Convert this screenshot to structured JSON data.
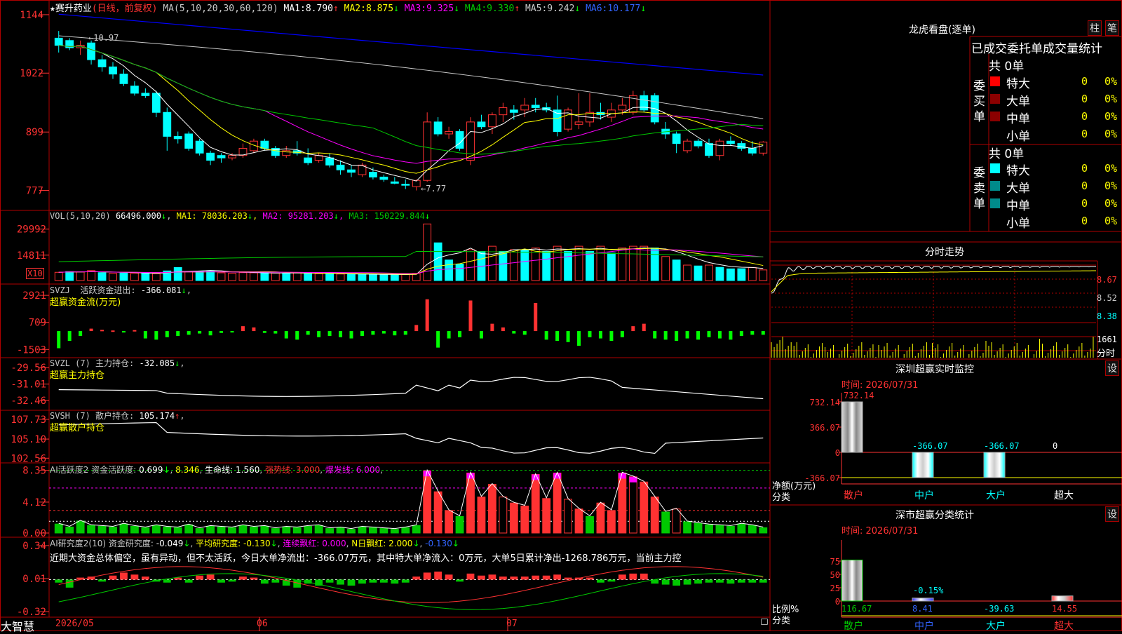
{
  "colors": {
    "up": "#ff3232",
    "down": "#00ffff",
    "border": "#b00000",
    "ma1": "#ffffff",
    "ma2": "#ffff00",
    "ma3": "#ff00ff",
    "ma4": "#00c800",
    "ma5": "#c8c8c8",
    "ma6": "#0000ff"
  },
  "main": {
    "stock_name": "赛升药业",
    "mode": "(日线，前复权)",
    "ma_def": "MA(5,10,20,30,60,120)",
    "ma": [
      {
        "label": "MA1:",
        "value": "8.790",
        "arrow": "↑"
      },
      {
        "label": "MA2:",
        "value": "8.875",
        "arrow": "↓"
      },
      {
        "label": "MA3:",
        "value": "9.325",
        "arrow": "↓"
      },
      {
        "label": "MA4:",
        "value": "9.330",
        "arrow": "↑"
      },
      {
        "label": "MA5:",
        "value": "9.242",
        "arrow": "↓"
      },
      {
        "label": "MA6:",
        "value": "10.177",
        "arrow": "↓"
      }
    ],
    "yticks": [
      "1144",
      "1022",
      "899",
      "777"
    ],
    "high_label": "←10.97",
    "low_label": "←7.77"
  },
  "vol": {
    "title": "VOL(5,10,20)",
    "value": "66496.000",
    "arrow": "↓",
    "ma": [
      {
        "label": "MA1:",
        "value": "78036.203",
        "arrow": "↓"
      },
      {
        "label": "MA2:",
        "value": "95281.203",
        "arrow": "↓"
      },
      {
        "label": "MA3:",
        "value": "150229.844",
        "arrow": "↓"
      }
    ],
    "yticks": [
      "29992",
      "14811"
    ],
    "unit": "X10"
  },
  "svzj": {
    "title": "SVZJ",
    "label": "活跃资金进出:",
    "value": "-366.081",
    "arrow": "↓",
    "extra": ",",
    "subtitle": "超赢资金流(万元)",
    "yticks": [
      "2921",
      "709",
      "-1503"
    ]
  },
  "svzl": {
    "title": "SVZL (7)",
    "label": "主力持仓:",
    "value": "-32.085",
    "arrow": "↓",
    "extra": ",",
    "subtitle": "超赢主力持仓",
    "yticks": [
      "-29.56",
      "-31.01",
      "-32.46"
    ]
  },
  "svsh": {
    "title": "SVSH (7)",
    "label": "散户持仓:",
    "value": "105.174",
    "arrow": "↑",
    "extra": ",",
    "subtitle": "超赢散户持仓",
    "yticks": [
      "107.73",
      "105.10",
      "102.56"
    ]
  },
  "ai1": {
    "title": "AI活跃度2",
    "label": "资金活跃度:",
    "value": "0.699",
    "arrow": "↓",
    "v2": "8.346",
    "lifeline": "生命线: 1.560",
    "strong": "强势线: 3.000",
    "burst": "爆发线: 6.000",
    "yticks": [
      "8.35",
      "4.12",
      "0.00"
    ]
  },
  "ai2": {
    "title": "AI研究度2(10)",
    "label": "资金研究度:",
    "value": "-0.049",
    "arrow": "↓",
    "avg": "平均研究度: -0.130",
    "avg_arrow": "↓",
    "red": "连续飘红: 0.000",
    "nday": "N日飘红: 2.000",
    "nday_arrow": "↓",
    "last": "-0.130",
    "last_arrow": "↓",
    "yticks": [
      "0.34",
      "0.01",
      "-0.32"
    ],
    "comment": "近期大资金总体偏空，虽有异动，但不太活跃，今日大单净流出：-366.07万元，其中特大单净流入：0万元，大单5日累计净出-1268.786万元，当前主力控"
  },
  "xaxis": {
    "app": "大智慧",
    "labels": [
      "2026/05",
      "06",
      "07"
    ]
  },
  "lhb": {
    "title": "龙虎看盘(逐单)",
    "btn1": "柱",
    "btn2": "笔",
    "tabs": [
      "已成交",
      "委托单",
      "成交量统计"
    ],
    "buy": {
      "side": "委买单",
      "total": "共 0单",
      "rows": [
        {
          "name": "特大",
          "val": "0",
          "pct": "0%",
          "color": "#ff0000"
        },
        {
          "name": "大单",
          "val": "0",
          "pct": "0%",
          "color": "#8b0000"
        },
        {
          "name": "中单",
          "val": "0",
          "pct": "0%",
          "color": "#8b0000"
        },
        {
          "name": "小单",
          "val": "0",
          "pct": "0%",
          "color": "#000000"
        }
      ]
    },
    "sell": {
      "side": "委卖单",
      "total": "共 0单",
      "rows": [
        {
          "name": "特大",
          "val": "0",
          "pct": "0%",
          "color": "#00ffff"
        },
        {
          "name": "大单",
          "val": "0",
          "pct": "0%",
          "color": "#008b8b"
        },
        {
          "name": "中单",
          "val": "0",
          "pct": "0%",
          "color": "#008b8b"
        },
        {
          "name": "小单",
          "val": "0",
          "pct": "0%",
          "color": "#000000"
        }
      ]
    }
  },
  "fenshi": {
    "title": "分时走势",
    "yticks": [
      "8.67",
      "8.52",
      "8.38"
    ],
    "vol_label": "1661",
    "unit": "分时"
  },
  "monitor": {
    "title": "深圳超赢实时监控",
    "btn": "设",
    "date": "时间: 2026/07/31",
    "yticks": [
      "732.14",
      "366.07",
      "0",
      "-366.07"
    ],
    "ylabel": "净额(万元)",
    "xlabel": "分类",
    "bars": [
      {
        "cat": "散户",
        "value": "732.14"
      },
      {
        "cat": "中户",
        "value": "-366.07"
      },
      {
        "cat": "大户",
        "value": "-366.07"
      },
      {
        "cat": "超大",
        "value": "0"
      }
    ]
  },
  "classify": {
    "title": "深市超赢分类统计",
    "btn": "设",
    "date": "时间: 2026/07/31",
    "yticks": [
      "75",
      "50",
      "25",
      "0"
    ],
    "ylabel": "比例%",
    "xlabel": "分类",
    "bars": [
      {
        "cat": "散户",
        "value": "116.67"
      },
      {
        "cat": "中户",
        "value": "8.41",
        "note": "-0.15%"
      },
      {
        "cat": "大户",
        "value": "-39.63"
      },
      {
        "cat": "超大",
        "value": "14.55"
      }
    ]
  },
  "chart_data": [
    {
      "type": "candlestick",
      "title": "赛升药业",
      "ylim": [
        7.5,
        11.6
      ],
      "candles": [
        [
          10.95,
          11.1,
          10.65,
          10.8
        ],
        [
          10.9,
          10.95,
          10.7,
          10.75
        ],
        [
          10.75,
          10.9,
          10.6,
          10.8
        ],
        [
          10.85,
          10.9,
          10.4,
          10.5
        ],
        [
          10.5,
          10.6,
          10.25,
          10.35
        ],
        [
          10.35,
          10.45,
          10.1,
          10.2
        ],
        [
          10.2,
          10.3,
          9.95,
          10.0
        ],
        [
          9.95,
          10.05,
          9.75,
          9.8
        ],
        [
          9.8,
          9.9,
          9.7,
          9.75
        ],
        [
          9.8,
          9.85,
          9.3,
          9.4
        ],
        [
          9.4,
          9.5,
          8.6,
          8.9
        ],
        [
          8.9,
          9.0,
          8.75,
          8.85
        ],
        [
          8.95,
          9.0,
          8.6,
          8.65
        ],
        [
          8.8,
          8.85,
          8.5,
          8.55
        ],
        [
          8.55,
          8.6,
          8.3,
          8.4
        ],
        [
          8.5,
          8.55,
          8.35,
          8.45
        ],
        [
          8.45,
          8.55,
          8.4,
          8.5
        ],
        [
          8.5,
          8.75,
          8.45,
          8.65
        ],
        [
          8.6,
          8.85,
          8.55,
          8.8
        ],
        [
          8.8,
          8.85,
          8.6,
          8.65
        ],
        [
          8.65,
          8.7,
          8.45,
          8.5
        ],
        [
          8.5,
          8.7,
          8.45,
          8.6
        ],
        [
          8.6,
          8.8,
          8.5,
          8.55
        ],
        [
          8.45,
          8.65,
          8.3,
          8.35
        ],
        [
          8.4,
          8.55,
          8.35,
          8.5
        ],
        [
          8.45,
          8.55,
          8.25,
          8.3
        ],
        [
          8.3,
          8.4,
          8.1,
          8.2
        ],
        [
          8.2,
          8.3,
          8.05,
          8.15
        ],
        [
          8.1,
          8.35,
          8.05,
          8.3
        ],
        [
          8.15,
          8.25,
          8.0,
          8.05
        ],
        [
          8.05,
          8.1,
          7.95,
          8.0
        ],
        [
          7.95,
          8.05,
          7.9,
          7.92
        ],
        [
          7.9,
          8.0,
          7.8,
          7.88
        ],
        [
          7.85,
          8.0,
          7.77,
          7.98
        ],
        [
          7.98,
          9.4,
          7.95,
          9.2
        ],
        [
          9.2,
          9.3,
          8.9,
          8.95
        ],
        [
          8.95,
          9.1,
          8.85,
          9.0
        ],
        [
          9.0,
          9.05,
          8.6,
          8.65
        ],
        [
          8.4,
          9.3,
          8.3,
          9.2
        ],
        [
          9.2,
          9.35,
          9.05,
          9.1
        ],
        [
          9.1,
          9.4,
          8.95,
          9.35
        ],
        [
          9.35,
          9.6,
          9.2,
          9.5
        ],
        [
          9.45,
          9.55,
          9.25,
          9.4
        ],
        [
          9.45,
          9.7,
          9.3,
          9.55
        ],
        [
          9.55,
          9.7,
          9.4,
          9.5
        ],
        [
          9.5,
          9.6,
          9.4,
          9.45
        ],
        [
          9.45,
          9.75,
          8.9,
          9.0
        ],
        [
          9.05,
          9.5,
          9.0,
          9.45
        ],
        [
          9.15,
          9.8,
          9.05,
          9.2
        ],
        [
          9.2,
          9.8,
          9.1,
          9.4
        ],
        [
          9.4,
          9.6,
          9.25,
          9.35
        ],
        [
          9.3,
          9.6,
          9.2,
          9.45
        ],
        [
          9.45,
          9.7,
          9.35,
          9.55
        ],
        [
          9.4,
          9.85,
          9.35,
          9.75
        ],
        [
          9.75,
          9.85,
          9.4,
          9.45
        ],
        [
          9.75,
          9.8,
          9.15,
          9.2
        ],
        [
          9.05,
          9.2,
          8.85,
          8.95
        ],
        [
          8.95,
          9.0,
          8.55,
          8.75
        ],
        [
          8.6,
          8.85,
          8.55,
          8.8
        ],
        [
          8.8,
          8.85,
          8.65,
          8.7
        ],
        [
          8.75,
          8.85,
          8.45,
          8.5
        ],
        [
          8.5,
          8.85,
          8.4,
          8.8
        ],
        [
          8.8,
          8.9,
          8.7,
          8.75
        ],
        [
          8.75,
          8.8,
          8.6,
          8.65
        ],
        [
          8.65,
          8.8,
          8.5,
          8.55
        ],
        [
          8.55,
          8.8,
          8.5,
          8.78
        ]
      ]
    },
    {
      "type": "bar",
      "title": "VOL(5,10,20)",
      "ylim": [
        0,
        36000
      ],
      "values": [
        [
          4800,
          1
        ],
        [
          5200,
          0
        ],
        [
          5000,
          1
        ],
        [
          5800,
          1
        ],
        [
          4600,
          0
        ],
        [
          4200,
          1
        ],
        [
          4400,
          0
        ],
        [
          4300,
          1
        ],
        [
          4200,
          0
        ],
        [
          4000,
          1
        ],
        [
          5600,
          0
        ],
        [
          7600,
          0
        ],
        [
          5200,
          1
        ],
        [
          5400,
          0
        ],
        [
          5600,
          0
        ],
        [
          4500,
          1
        ],
        [
          4300,
          1
        ],
        [
          4600,
          1
        ],
        [
          4500,
          1
        ],
        [
          4400,
          0
        ],
        [
          4300,
          1
        ],
        [
          4200,
          0
        ],
        [
          4600,
          1
        ],
        [
          4100,
          0
        ],
        [
          4000,
          1
        ],
        [
          3900,
          0
        ],
        [
          3800,
          1
        ],
        [
          3700,
          0
        ],
        [
          3600,
          0
        ],
        [
          3500,
          0
        ],
        [
          3400,
          0
        ],
        [
          3400,
          0
        ],
        [
          3500,
          1
        ],
        [
          4200,
          1
        ],
        [
          33000,
          1
        ],
        [
          22000,
          0
        ],
        [
          12000,
          0
        ],
        [
          9600,
          0
        ],
        [
          18000,
          1
        ],
        [
          17000,
          0
        ],
        [
          20000,
          1
        ],
        [
          17000,
          0
        ],
        [
          18000,
          1
        ],
        [
          18000,
          0
        ],
        [
          19000,
          1
        ],
        [
          17000,
          0
        ],
        [
          20000,
          1
        ],
        [
          17000,
          0
        ],
        [
          20000,
          1
        ],
        [
          17000,
          0
        ],
        [
          20000,
          1
        ],
        [
          16000,
          0
        ],
        [
          19000,
          1
        ],
        [
          20000,
          1
        ],
        [
          20000,
          1
        ],
        [
          19000,
          0
        ],
        [
          14000,
          1
        ],
        [
          12000,
          0
        ],
        [
          9000,
          1
        ],
        [
          8500,
          0
        ],
        [
          9000,
          1
        ],
        [
          7700,
          0
        ],
        [
          6800,
          0
        ],
        [
          6900,
          0
        ],
        [
          7600,
          1
        ],
        [
          6200,
          1
        ]
      ]
    }
  ]
}
